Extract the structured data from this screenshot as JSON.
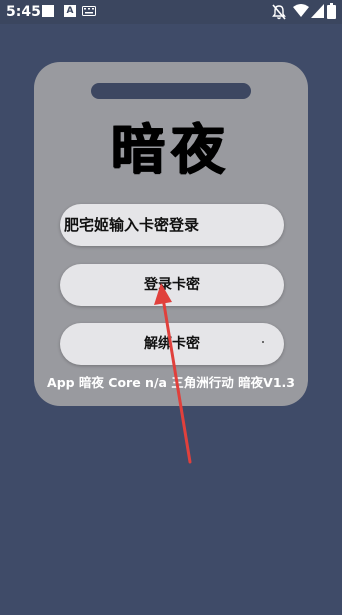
{
  "status_bar": {
    "time": "5:45",
    "badge_a": "A",
    "icons": [
      "notification-square-icon",
      "notification-a-icon",
      "keyboard-icon",
      "do-not-disturb-icon",
      "wifi-icon",
      "cellular-signal-icon",
      "battery-icon"
    ]
  },
  "card": {
    "title": "暗夜",
    "input": {
      "placeholder": "肥宅姬输入卡密登录",
      "value": ""
    },
    "login_button": "登录卡密",
    "unbind_button": "解绑卡密"
  },
  "footer": {
    "text": "App 暗夜 Core n/a 三角洲行动 暗夜V1.3"
  },
  "colors": {
    "background": "#3f4b68",
    "card": "#999a9f",
    "button": "#e5e5e8",
    "annotation_arrow": "#e0403c"
  }
}
